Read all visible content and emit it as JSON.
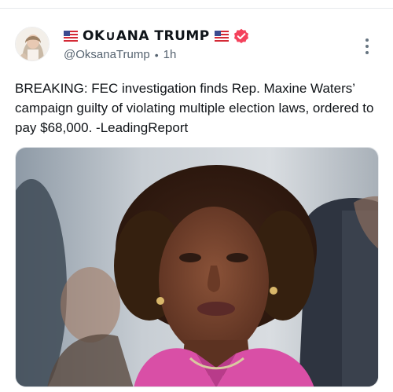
{
  "post": {
    "author": {
      "display_name": "OK∪ANA TRUMP",
      "handle": "@OksanaTrump",
      "flag_icon": "us-flag-icon",
      "verified_icon": "verified-badge-icon",
      "verified_color": "#f4425c"
    },
    "timestamp": "1h",
    "separator": "•",
    "text": "BREAKING: FEC investigation finds Rep. Maxine Waters’ campaign guilty of violating multiple election laws, ordered to pay $68,000. -LeadingReport",
    "more_icon": "more-vertical-icon"
  }
}
